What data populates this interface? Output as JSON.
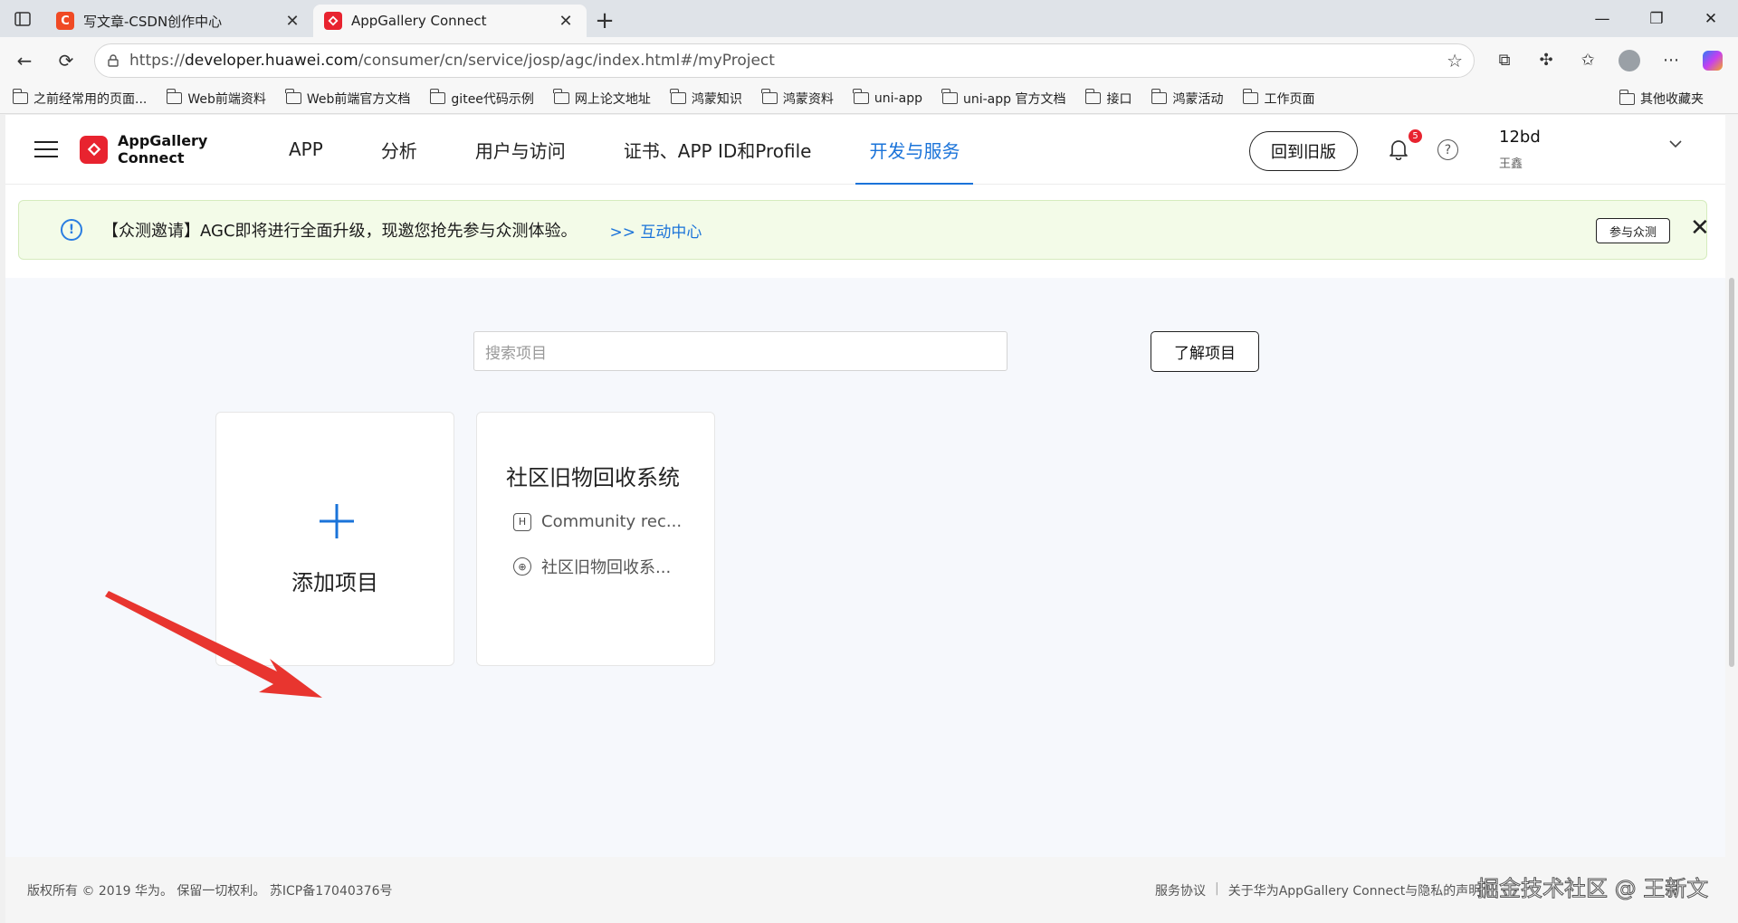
{
  "browser": {
    "tabs": [
      {
        "title": "写文章-CSDN创作中心",
        "favicon_letter": "C",
        "favicon_color": "#f04a24"
      },
      {
        "title": "AppGallery Connect",
        "favicon_color": "#e8232f"
      }
    ],
    "url": {
      "scheme": "https://",
      "host": "developer.huawei.com",
      "path": "/consumer/cn/service/josp/agc/index.html#/myProject"
    },
    "bookmarks": [
      "之前经常用的页面...",
      "Web前端资料",
      "Web前端官方文档",
      "gitee代码示例",
      "网上论文地址",
      "鸿蒙知识",
      "鸿蒙资料",
      "uni-app",
      "uni-app 官方文档",
      "接口",
      "鸿蒙活动",
      "工作页面"
    ],
    "bookmarks_other": "其他收藏夹"
  },
  "header": {
    "brand": "AppGallery Connect",
    "menu": [
      "APP",
      "分析",
      "用户与访问",
      "证书、APP ID和Profile",
      "开发与服务"
    ],
    "active_menu": "开发与服务",
    "old_version_button": "回到旧版",
    "notification_count": "5",
    "user_name": "12bd",
    "user_sub": "王鑫"
  },
  "notice": {
    "message": "【众测邀请】AGC即将进行全面升级，现邀您抢先参与众测体验。",
    "link": ">> 互动中心",
    "join_button": "参与众测"
  },
  "main": {
    "search_placeholder": "搜索项目",
    "learn_button": "了解项目",
    "add_label": "添加项目",
    "project": {
      "title": "社区旧物回收系统",
      "app_name": "Community rec...",
      "web_name": "社区旧物回收系...",
      "app_icon_letter": "H"
    }
  },
  "footer": {
    "copyright": "版权所有 © 2019 华为。 保留一切权利。 苏ICP备17040376号",
    "links": [
      "服务协议",
      "关于华为AppGallery Connect与隐私的声明"
    ]
  },
  "watermark": "掘金技术社区 @ 王新文",
  "colors": {
    "accent": "#1a73d9",
    "brand_red": "#e8232f",
    "notice_bg": "#f3fbe8"
  }
}
